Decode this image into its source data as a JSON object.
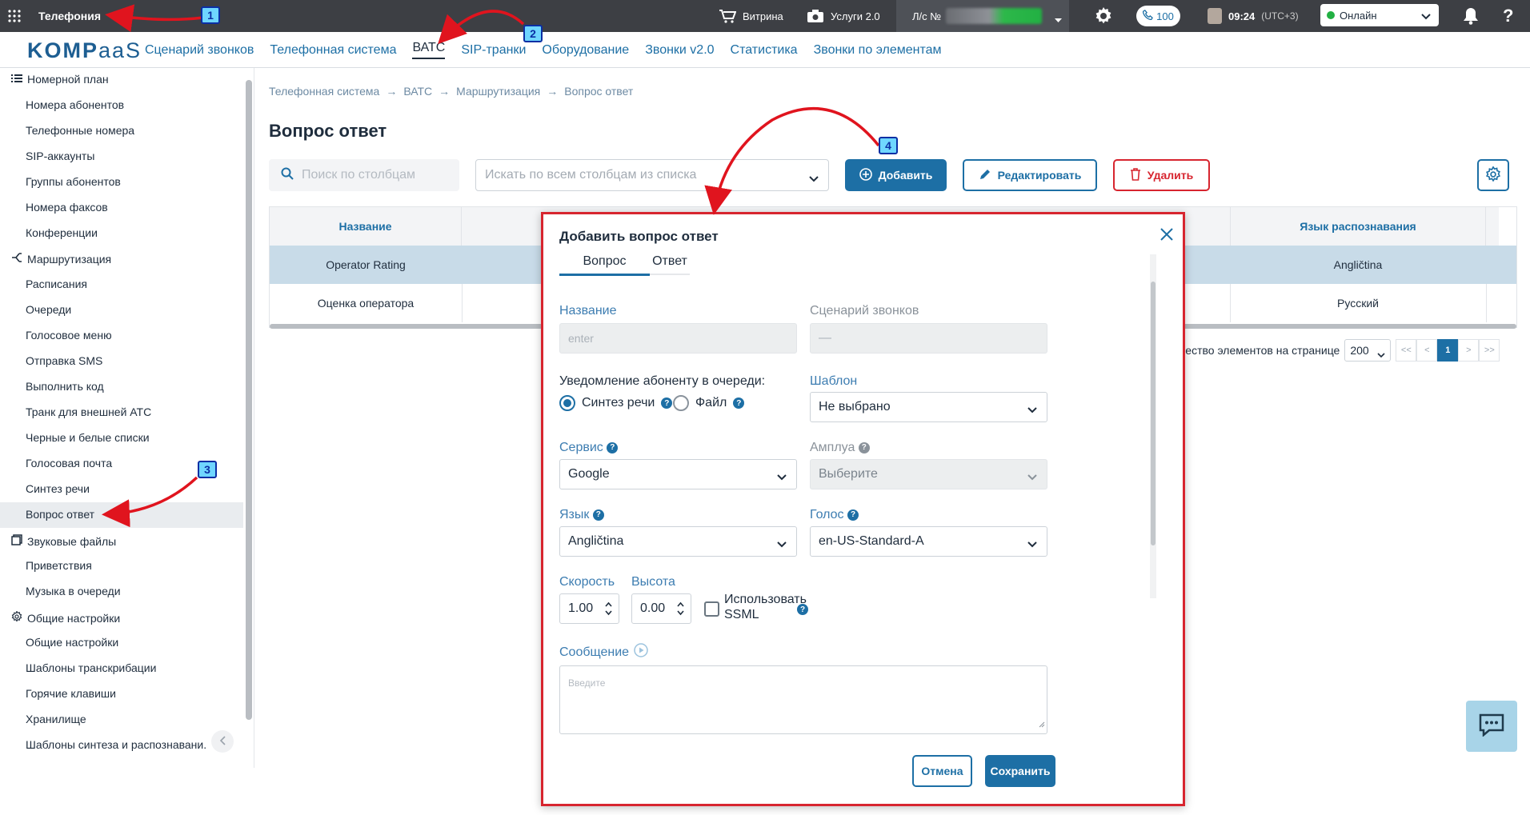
{
  "topbar": {
    "app_title": "Телефония",
    "showcase": "Витрина",
    "services": "Услуги 2.0",
    "account_prefix": "Л/с №",
    "counter": "100",
    "time": "09:24",
    "timezone": "(UTC+3)",
    "status": "Онлайн",
    "help": "?"
  },
  "nav": {
    "logo_brand": "KOMP",
    "logo_suffix": "aaS",
    "links": [
      "Сценарий звонков",
      "Телефонная система",
      "ВАТС",
      "SIP-транки",
      "Оборудование",
      "Звонки v2.0",
      "Статистика",
      "Звонки по элементам"
    ]
  },
  "sidebar": {
    "group_numbering": "Номерной план",
    "numbering": [
      "Номера абонентов",
      "Телефонные номера",
      "SIP-аккаунты",
      "Группы абонентов",
      "Номера факсов",
      "Конференции"
    ],
    "group_routing": "Маршрутизация",
    "routing": [
      "Расписания",
      "Очереди",
      "Голосовое меню",
      "Отправка SMS",
      "Выполнить код",
      "Транк для внешней АТС",
      "Черные и белые списки",
      "Голосовая почта",
      "Синтез речи",
      "Вопрос ответ"
    ],
    "group_sounds": "Звуковые файлы",
    "sounds": [
      "Приветствия",
      "Музыка в очереди"
    ],
    "group_settings": "Общие настройки",
    "settings": [
      "Общие настройки",
      "Шаблоны транскрибации",
      "Горячие клавиши",
      "Хранилище",
      "Шаблоны синтеза и распознавани."
    ]
  },
  "breadcrumb": [
    "Телефонная система",
    "ВАТС",
    "Маршрутизация",
    "Вопрос ответ"
  ],
  "page": {
    "title": "Вопрос ответ",
    "search_placeholder": "Поиск по столбцам",
    "filter_placeholder": "Искать по всем столбцам из списка",
    "add": "Добавить",
    "edit": "Редактировать",
    "delete": "Удалить"
  },
  "table": {
    "headers": [
      "Название",
      "Язык распознавания"
    ],
    "rows": [
      [
        "Operator Rating",
        "Angličtina"
      ],
      [
        "Оценка оператора",
        "Русский"
      ]
    ]
  },
  "pagination": {
    "per_page_label": "чество элементов на странице",
    "per_page": "200",
    "first": "<<",
    "prev": "<",
    "current": "1",
    "next": ">",
    "last": ">>"
  },
  "modal": {
    "title": "Добавить вопрос ответ",
    "tabs": [
      "Вопрос",
      "Ответ"
    ],
    "name_label": "Название",
    "name_value": "enter",
    "scenario_label": "Сценарий звонков",
    "scenario_value": "—",
    "notify_label": "Уведомление абоненту в очереди:",
    "radio_synth": "Синтез речи",
    "radio_file": "Файл",
    "template_label": "Шаблон",
    "template_value": "Не выбрано",
    "service_label": "Сервис",
    "service_value": "Google",
    "role_label": "Амплуа",
    "role_value": "Выберите",
    "lang_label": "Язык",
    "lang_value": "Angličtina",
    "voice_label": "Голос",
    "voice_value": "en-US-Standard-A",
    "speed_label": "Скорость",
    "speed_value": "1.00",
    "pitch_label": "Высота",
    "pitch_value": "0.00",
    "ssml_label_1": "Использовать",
    "ssml_label_2": "SSML",
    "message_label": "Сообщение",
    "message_placeholder": "Введите",
    "cancel": "Отмена",
    "save": "Сохранить"
  },
  "annotations": [
    "1",
    "2",
    "3",
    "4"
  ],
  "colors": {
    "accent": "#1d6fa5",
    "danger": "#d7252f",
    "arrow": "#e0141e",
    "topbar": "#3d3f44"
  }
}
